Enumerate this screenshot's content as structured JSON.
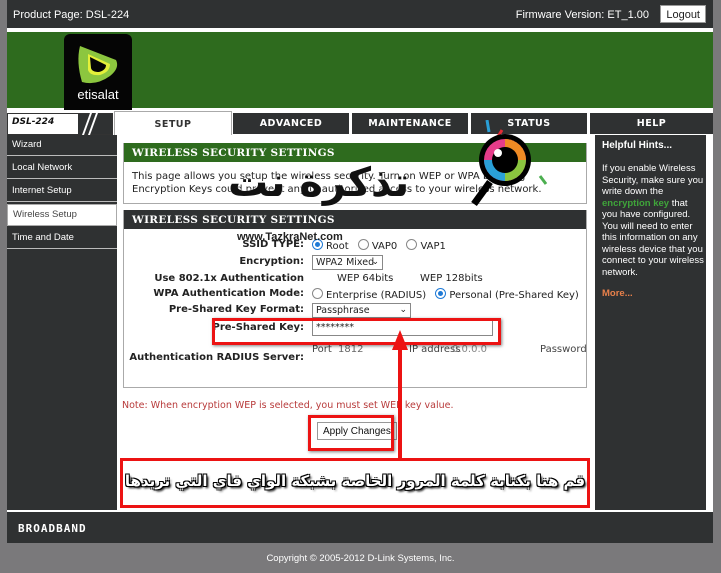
{
  "topbar": {
    "product": "Product Page: DSL-224",
    "firmware": "Firmware Version: ET_1.00",
    "logout_label": "Logout"
  },
  "brand": {
    "logo_text": "etisalat",
    "model": "DSL-224",
    "color_green": "#2e6b1e",
    "color_dark": "#2f3132"
  },
  "tabs": [
    {
      "label": "SETUP",
      "active": true
    },
    {
      "label": "ADVANCED",
      "active": false
    },
    {
      "label": "MAINTENANCE",
      "active": false
    },
    {
      "label": "STATUS",
      "active": false
    },
    {
      "label": "HELP",
      "active": false
    }
  ],
  "sidebar": {
    "items": [
      {
        "label": "Wizard",
        "active": false
      },
      {
        "label": "Local Network",
        "active": false
      },
      {
        "label": "Internet Setup",
        "active": false
      },
      {
        "label": "Wireless Setup",
        "active": true
      },
      {
        "label": "Time and Date",
        "active": false
      }
    ]
  },
  "intro": {
    "title": "WIRELESS SECURITY SETTINGS",
    "text": "This page allows you setup the wireless security. Turn on WEP or WPA by using Encryption Keys could prevent any unauthorized access to your wireless network."
  },
  "settings": {
    "title": "WIRELESS SECURITY SETTINGS",
    "ssid_type_label": "SSID TYPE:",
    "ssid_options": [
      {
        "label": "Root",
        "selected": true
      },
      {
        "label": "VAP0",
        "selected": false
      },
      {
        "label": "VAP1",
        "selected": false
      }
    ],
    "encryption_label": "Encryption:",
    "encryption_value": "WPA2 Mixed",
    "auth8021x_label": "Use 802.1x Authentication",
    "wep64": "WEP 64bits",
    "wep128": "WEP 128bits",
    "wpa_mode_label": "WPA Authentication Mode:",
    "wpa_modes": [
      {
        "label": "Enterprise (RADIUS)",
        "selected": false
      },
      {
        "label": "Personal (Pre-Shared Key)",
        "selected": true
      }
    ],
    "psk_format_label": "Pre-Shared Key Format:",
    "psk_format_value": "Passphrase",
    "psk_label": "Pre-Shared Key:",
    "psk_value": "********",
    "radius_label": "Authentication RADIUS Server:",
    "port_label": "Port",
    "port_value": "1812",
    "ip_label": "IP address",
    "ip_value": "0.0.0.0",
    "password_label": "Password"
  },
  "note": "Note: When encryption WEP is selected, you must set WEP key value.",
  "apply_label": "Apply Changes",
  "hints": {
    "title": "Helpful Hints...",
    "text_before": "If you enable Wireless Security, make sure you write down the ",
    "highlight": "encryption key",
    "text_after": " that you have configured. You will need to enter this information on any wireless device that you connect to your wireless network.",
    "more": "More..."
  },
  "footer": {
    "brand": "BROADBAND",
    "copyright": "Copyright © 2005-2012 D-Link Systems, Inc."
  },
  "annotation": {
    "caption": "قم هنا بكتابة كلمة المرور الخاصة بشبكة الواي فاي التي تريدها",
    "highlight_color": "#ec1313"
  },
  "watermark": {
    "text": "تذكرة نت",
    "url": "www.TazkraNet.com"
  }
}
